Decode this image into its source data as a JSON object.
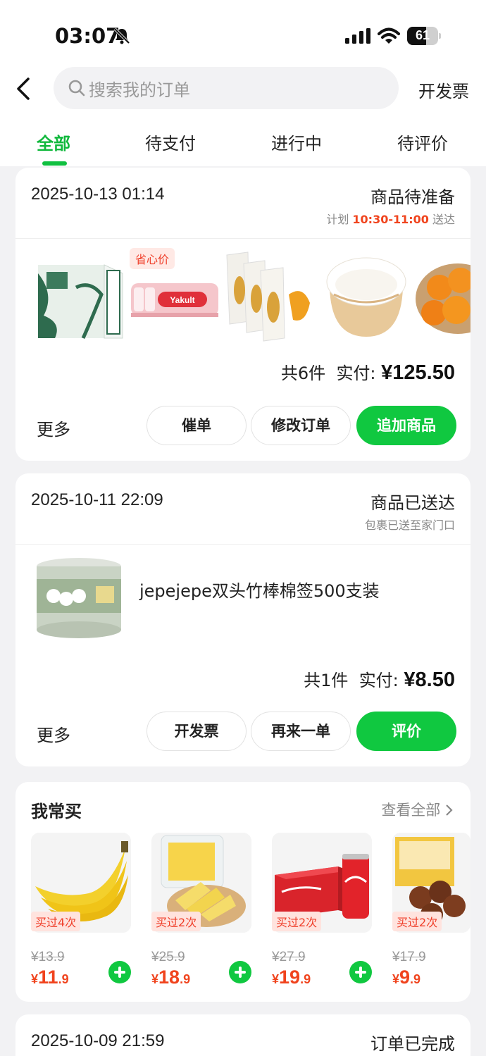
{
  "status_bar": {
    "time": "03:07",
    "battery": "61",
    "battery_level": 0.61
  },
  "header": {
    "search_placeholder": "搜索我的订单",
    "invoice_label": "开发票"
  },
  "tabs": [
    {
      "label": "全部",
      "active": true
    },
    {
      "label": "待支付",
      "active": false
    },
    {
      "label": "进行中",
      "active": false
    },
    {
      "label": "待评价",
      "active": false
    }
  ],
  "orders": [
    {
      "date": "2025-10-13 01:14",
      "status": "商品待准备",
      "sub_prefix": "计划 ",
      "sub_highlight": "10:30-11:00",
      "sub_suffix": " 送达",
      "badge": "省心价",
      "count_label": "共6件",
      "paid_label": "实付:",
      "amount": "¥125.50",
      "more": "更多",
      "buttons": [
        "催单",
        "修改订单",
        "追加商品"
      ]
    },
    {
      "date": "2025-10-11 22:09",
      "status": "商品已送达",
      "sub": "包裹已送至家门口",
      "product_name": "jepejepe双头竹棒棉签500支装",
      "count_label": "共1件",
      "paid_label": "实付:",
      "amount": "¥8.50",
      "more": "更多",
      "buttons": [
        "开发票",
        "再来一单",
        "评价"
      ]
    },
    {
      "date": "2025-10-09 21:59",
      "status": "订单已完成"
    }
  ],
  "frequent": {
    "title": "我常买",
    "view_all": "查看全部",
    "items": [
      {
        "badge": "买过4次",
        "old_price": "¥13.9",
        "currency": "¥",
        "price_int": "11",
        "price_dec": ".9"
      },
      {
        "badge": "买过2次",
        "old_price": "¥25.9",
        "currency": "¥",
        "price_int": "18",
        "price_dec": ".9"
      },
      {
        "badge": "买过2次",
        "old_price": "¥27.9",
        "currency": "¥",
        "price_int": "19",
        "price_dec": ".9"
      },
      {
        "badge": "买过2次",
        "old_price": "¥17.9",
        "currency": "¥",
        "price_int": "9",
        "price_dec": ".9"
      }
    ]
  },
  "colors": {
    "accent": "#10c840",
    "price_red": "#f0441e"
  }
}
